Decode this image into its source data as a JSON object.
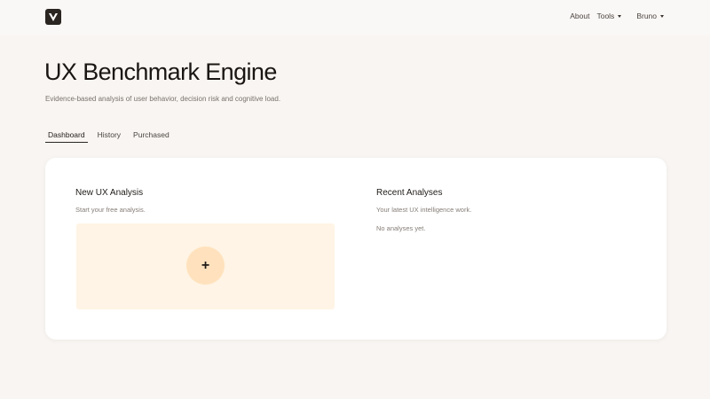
{
  "nav": {
    "about": "About",
    "tools": "Tools",
    "user": "Bruno"
  },
  "header": {
    "title": "UX Benchmark Engine",
    "subtitle": "Evidence-based analysis of user behavior, decision risk and cognitive load."
  },
  "tabs": [
    {
      "label": "Dashboard",
      "active": true
    },
    {
      "label": "History",
      "active": false
    },
    {
      "label": "Purchased",
      "active": false
    }
  ],
  "new_analysis": {
    "title": "New UX Analysis",
    "subtitle": "Start your free analysis.",
    "add_icon": "+"
  },
  "recent": {
    "title": "Recent Analyses",
    "subtitle": "Your latest UX intelligence work.",
    "empty": "No analyses yet."
  },
  "colors": {
    "background": "#f8f5f2",
    "dropzone": "#fff4e5",
    "add_circle": "#ffe2bd",
    "logo": "#2a2520"
  }
}
